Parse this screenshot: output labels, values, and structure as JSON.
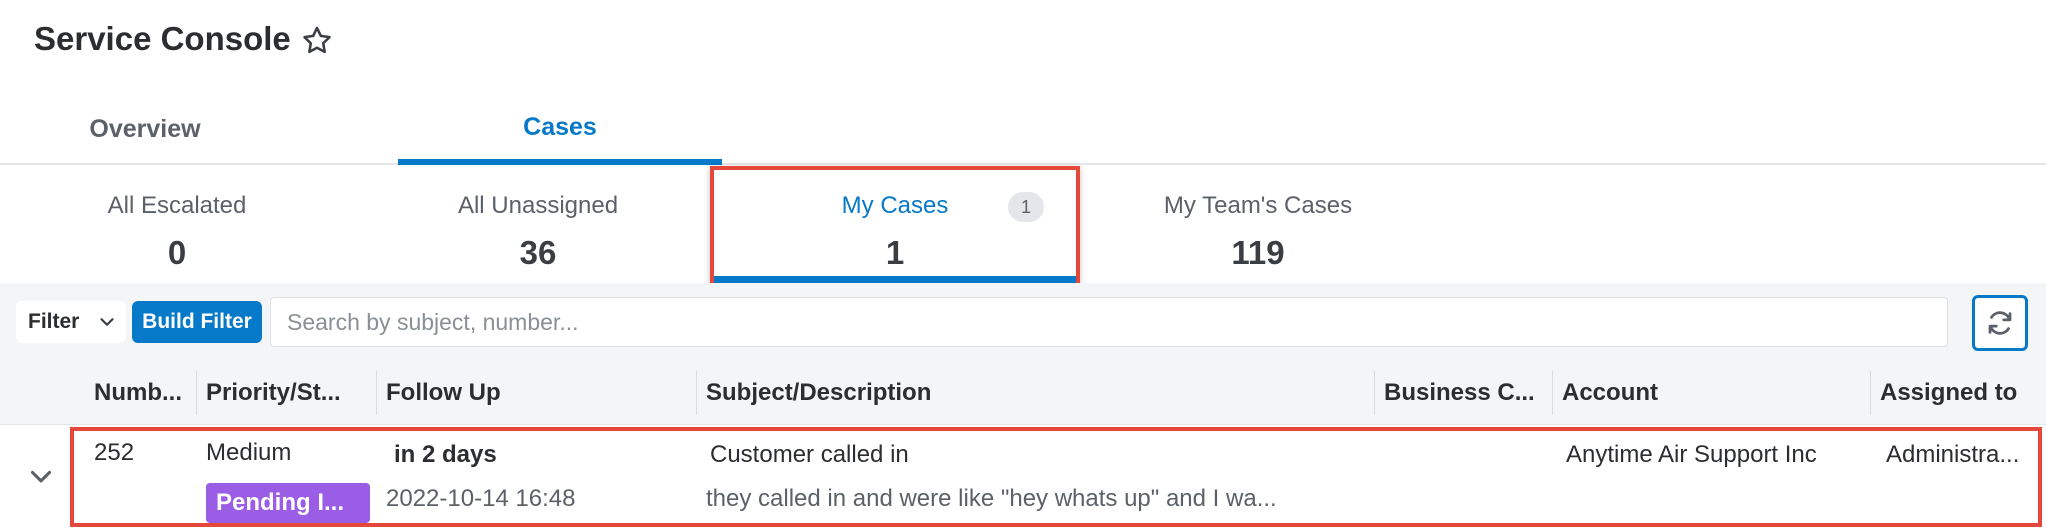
{
  "header": {
    "title": "Service Console",
    "favorite_icon": "star-outline-icon"
  },
  "main_tabs": [
    {
      "label": "Overview",
      "active": false
    },
    {
      "label": "Cases",
      "active": true
    }
  ],
  "sub_tabs": [
    {
      "label": "All Escalated",
      "count": "0",
      "active": false
    },
    {
      "label": "All Unassigned",
      "count": "36",
      "active": false
    },
    {
      "label": "My Cases",
      "count": "1",
      "badge": "1",
      "active": true
    },
    {
      "label": "My Team's Cases",
      "count": "119",
      "active": false
    }
  ],
  "filter_bar": {
    "filter_label": "Filter",
    "build_filter_label": "Build Filter",
    "search_placeholder": "Search by subject, number...",
    "refresh_icon": "refresh-icon"
  },
  "table": {
    "columns": [
      "Numb...",
      "Priority/St...",
      "Follow Up",
      "Subject/Description",
      "Business C...",
      "Account",
      "Assigned to"
    ],
    "rows": [
      {
        "number": "252",
        "priority": "Medium",
        "status": "Pending I...",
        "follow_up_relative": "in 2 days",
        "follow_up_date": "2022-10-14 16:48",
        "subject": "Customer called in",
        "description": "they called in and were like \"hey whats up\" and I wa...",
        "business_center": "",
        "account": "Anytime Air Support Inc",
        "assigned_to": "Administra..."
      }
    ]
  },
  "colors": {
    "accent": "#0679c8",
    "highlight": "#e5483b",
    "status_pending": "#9b5de5"
  }
}
